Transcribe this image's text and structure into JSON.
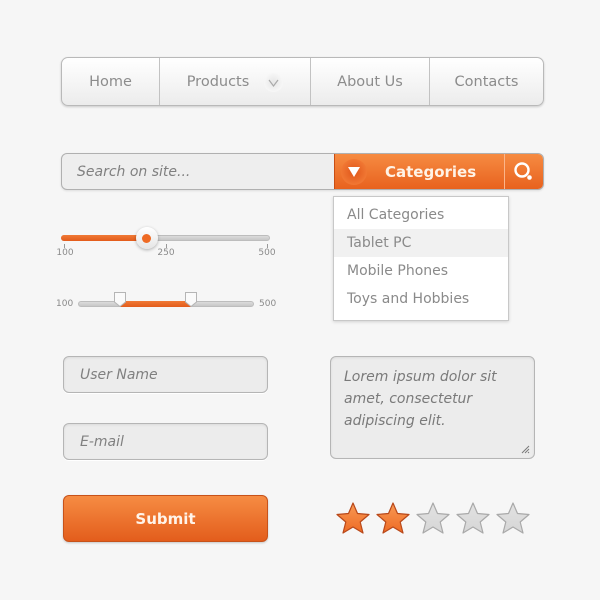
{
  "nav": {
    "items": [
      {
        "label": "Home"
      },
      {
        "label": "Products",
        "has_dropdown": true,
        "icon": "chevron-down-icon"
      },
      {
        "label": "About Us"
      },
      {
        "label": "Contacts"
      }
    ]
  },
  "search": {
    "placeholder": "Search on site...",
    "category_label": "Categories",
    "category_icon": "triangle-down-icon",
    "search_icon": "search-icon"
  },
  "dropdown": {
    "items": [
      {
        "label": "All Categories",
        "active": false
      },
      {
        "label": "Tablet PC",
        "active": true
      },
      {
        "label": "Mobile Phones",
        "active": false
      },
      {
        "label": "Toys and Hobbies",
        "active": false
      }
    ]
  },
  "slider_single": {
    "ticks": [
      "100",
      "250",
      "500"
    ],
    "position_fraction": 0.41
  },
  "slider_range": {
    "min_label": "100",
    "max_label": "500",
    "low_fraction": 0.24,
    "high_fraction": 0.64
  },
  "form": {
    "username_placeholder": "User Name",
    "email_placeholder": "E-mail",
    "textarea_text": "Lorem ipsum dolor sit amet, consectetur adipiscing elit.",
    "submit_label": "Submit"
  },
  "rating": {
    "value": 2,
    "max": 5
  },
  "colors": {
    "accent": "#ee6a24",
    "accent_dark": "#c7521a",
    "star_empty": "#d6d6d6"
  }
}
